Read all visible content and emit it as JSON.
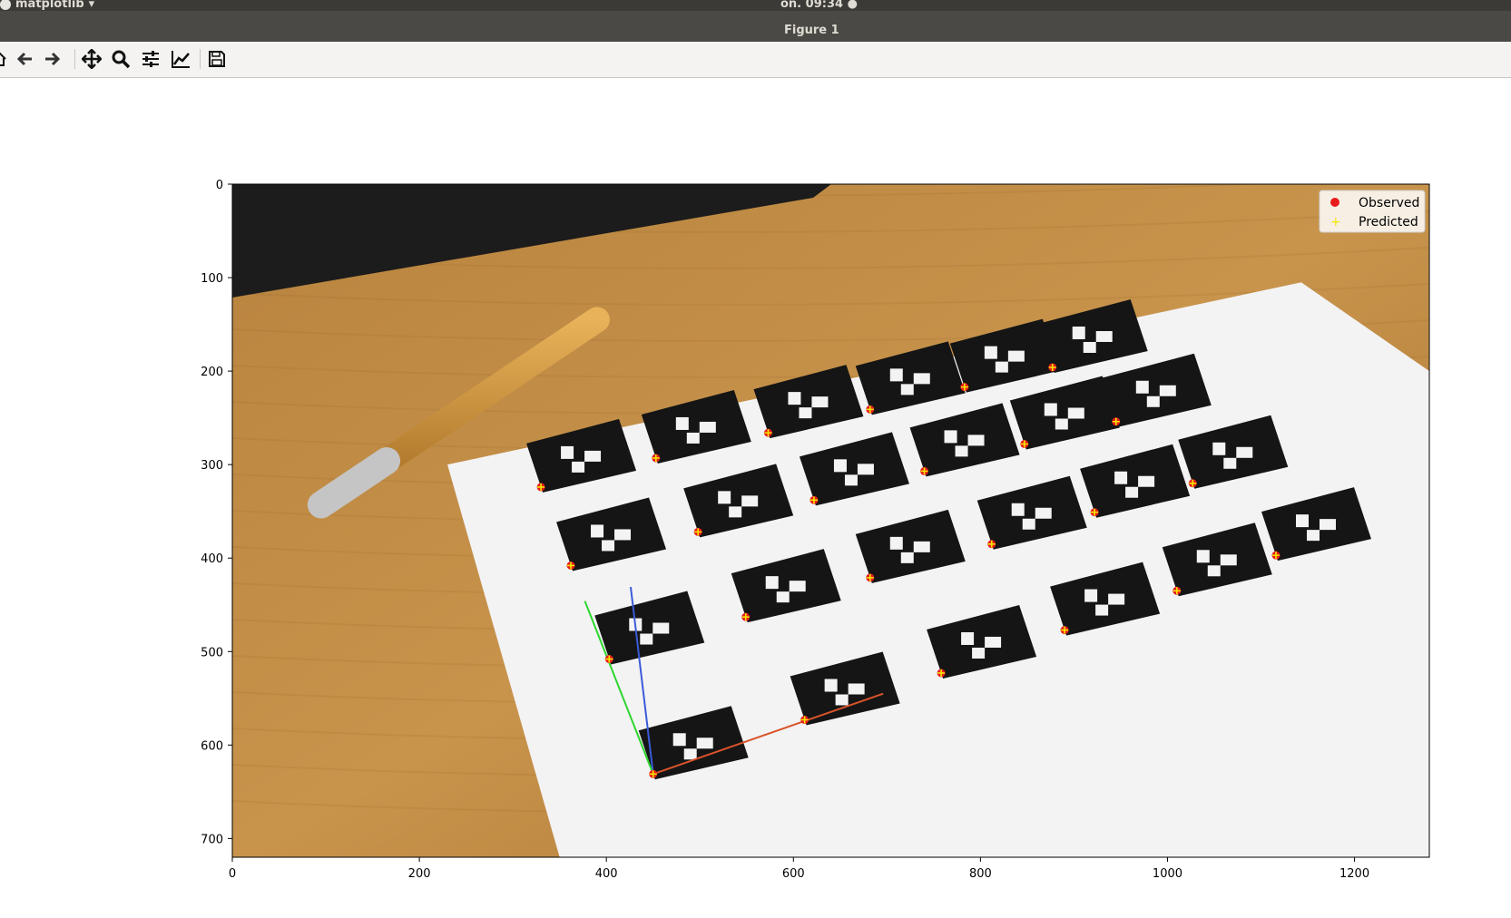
{
  "system_bar": {
    "app_name": "matplotlib",
    "clock": "on. 09:34"
  },
  "window": {
    "title": "Figure 1"
  },
  "toolbar": {
    "buttons": [
      {
        "name": "home-icon"
      },
      {
        "name": "back-arrow-icon"
      },
      {
        "name": "forward-arrow-icon"
      },
      {
        "name": "pan-icon"
      },
      {
        "name": "zoom-icon"
      },
      {
        "name": "subplots-configure-icon"
      },
      {
        "name": "edit-axis-icon"
      },
      {
        "name": "save-icon"
      }
    ]
  },
  "chart_data": {
    "type": "scatter",
    "title": "",
    "xlabel": "",
    "ylabel": "",
    "xlim": [
      0,
      1280
    ],
    "ylim": [
      720,
      0
    ],
    "x_ticks": [
      "0",
      "200",
      "400",
      "600",
      "800",
      "1000",
      "1200"
    ],
    "y_ticks": [
      "0",
      "100",
      "200",
      "300",
      "400",
      "500",
      "600",
      "700"
    ],
    "legend_position": "top-right",
    "series": [
      {
        "name": "Observed",
        "marker": "circle",
        "color": "#e81b1b",
        "points": [
          [
            330,
            324
          ],
          [
            362,
            408
          ],
          [
            403,
            508
          ],
          [
            450,
            631
          ],
          [
            453,
            293
          ],
          [
            498,
            372
          ],
          [
            549,
            463
          ],
          [
            612,
            573
          ],
          [
            573,
            266
          ],
          [
            622,
            338
          ],
          [
            682,
            421
          ],
          [
            758,
            523
          ],
          [
            682,
            241
          ],
          [
            740,
            307
          ],
          [
            812,
            385
          ],
          [
            890,
            477
          ],
          [
            783,
            217
          ],
          [
            847,
            278
          ],
          [
            922,
            351
          ],
          [
            1010,
            435
          ],
          [
            877,
            196
          ],
          [
            945,
            254
          ],
          [
            1027,
            320
          ],
          [
            1116,
            397
          ]
        ]
      },
      {
        "name": "Predicted",
        "marker": "plus",
        "color": "#f2e600",
        "points": [
          [
            330,
            324
          ],
          [
            362,
            408
          ],
          [
            403,
            508
          ],
          [
            450,
            631
          ],
          [
            453,
            293
          ],
          [
            498,
            372
          ],
          [
            549,
            463
          ],
          [
            612,
            573
          ],
          [
            573,
            266
          ],
          [
            622,
            338
          ],
          [
            682,
            421
          ],
          [
            758,
            523
          ],
          [
            682,
            241
          ],
          [
            740,
            307
          ],
          [
            812,
            385
          ],
          [
            890,
            477
          ],
          [
            783,
            217
          ],
          [
            847,
            278
          ],
          [
            922,
            351
          ],
          [
            1010,
            435
          ],
          [
            877,
            196
          ],
          [
            945,
            254
          ],
          [
            1027,
            320
          ],
          [
            1116,
            397
          ]
        ]
      }
    ],
    "axes_lines": [
      {
        "color": "#3a5bd9",
        "from": [
          450,
          631
        ],
        "to": [
          426,
          431
        ]
      },
      {
        "color": "#2ed62e",
        "from": [
          450,
          631
        ],
        "to": [
          377,
          446
        ]
      },
      {
        "color": "#d8542a",
        "from": [
          450,
          631
        ],
        "to": [
          696,
          545
        ]
      }
    ],
    "background": "photo of printed ArUco marker grid on a wooden desk"
  }
}
